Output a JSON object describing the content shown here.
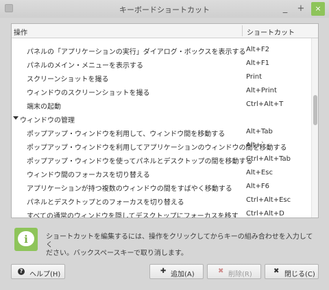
{
  "window": {
    "title": "キーボードショートカット",
    "minimize": "_",
    "maximize": "+",
    "close": "×"
  },
  "table": {
    "col_action": "操作",
    "col_shortcut": "ショートカット",
    "rows": [
      {
        "type": "item",
        "name": "パネルの「アプリケーションの実行」ダイアログ・ボックスを表示する",
        "key": "Alt+F2"
      },
      {
        "type": "item",
        "name": "パネルのメイン・メニューを表示する",
        "key": "Alt+F1"
      },
      {
        "type": "item",
        "name": "スクリーンショットを撮る",
        "key": "Print"
      },
      {
        "type": "item",
        "name": "ウィンドウのスクリーンショットを撮る",
        "key": "Alt+Print"
      },
      {
        "type": "item",
        "name": "端末の起動",
        "key": "Ctrl+Alt+T"
      },
      {
        "type": "category",
        "name": "ウィンドウの管理",
        "key": ""
      },
      {
        "type": "item",
        "name": "ポップアップ・ウィンドウを利用して、ウィンドウ間を移動する",
        "key": "Alt+Tab"
      },
      {
        "type": "item",
        "name": "ポップアップ・ウィンドウを利用してアプリケーションのウィンドウの間を移動する",
        "key": "Alt+`"
      },
      {
        "type": "item",
        "name": "ポップアップ・ウィンドウを使ってパネルとデスクトップの間を移動する",
        "key": "Ctrl+Alt+Tab"
      },
      {
        "type": "item",
        "name": "ウィンドウ間のフォーカスを切り替える",
        "key": "Alt+Esc"
      },
      {
        "type": "item",
        "name": "アプリケーションが持つ複数のウィンドウの間をすばやく移動する",
        "key": "Alt+F6"
      },
      {
        "type": "item",
        "name": "パネルとデスクトップとのフォーカスを切り替える",
        "key": "Ctrl+Alt+Esc"
      },
      {
        "type": "item",
        "name": "すべての通常のウィンドウを隠してデスクトップにフォーカスを移す",
        "key": "Ctrl+Alt+D"
      }
    ],
    "scroll_position": 0.38
  },
  "info": {
    "icon": "info-icon",
    "line1": "ショートカットを編集するには、操作をクリックしてからキーの組み合わせを入力してく",
    "line2": "ださい。バックスペースキーで取り消します。"
  },
  "buttons": {
    "help": "ヘルプ(H)",
    "add": "追加(A)",
    "delete": "削除(R)",
    "close": "閉じる(C)"
  },
  "colors": {
    "accent": "#8ec45a"
  }
}
